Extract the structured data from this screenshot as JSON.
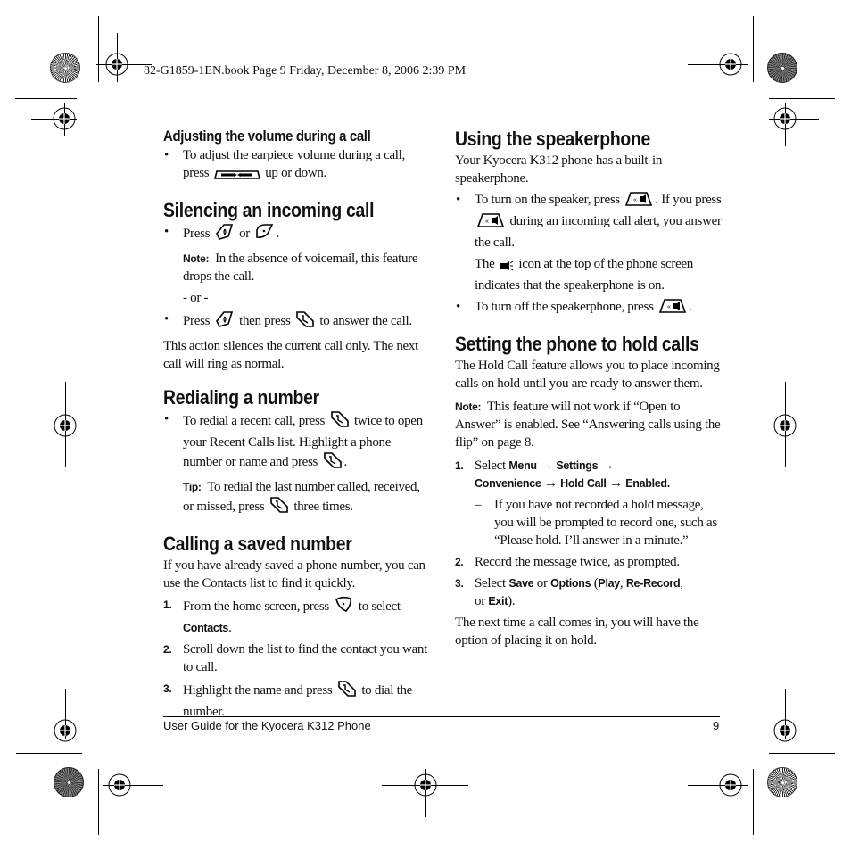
{
  "slug": "82-G1859-1EN.book  Page 9  Friday, December 8, 2006  2:39 PM",
  "left_column": {
    "adjust_volume": {
      "heading": "Adjusting the volume during a call",
      "bullet_pre": "To adjust the earpiece volume during a call, press",
      "bullet_post": "up or down.",
      "icon": "volume-key-icon"
    },
    "silencing": {
      "heading": "Silencing an incoming call",
      "bullet1_pre": "Press",
      "bullet1_mid": "or",
      "bullet1_post": ".",
      "note_label": "Note:",
      "note_text": "In the absence of voicemail, this feature drops the call.",
      "or_text": "- or -",
      "bullet2_pre": "Press",
      "bullet2_mid": "then press",
      "bullet2_post": "to answer the call.",
      "para": "This action silences the current call only. The next call will ring as normal."
    },
    "redialing": {
      "heading": "Redialing a number",
      "bullet_a": "To redial a recent call, press",
      "bullet_b": "twice to open your Recent Calls list. Highlight a phone number or name and press",
      "bullet_c": ".",
      "tip_label": "Tip:",
      "tip_pre": "To redial the last number called, received, or missed, press",
      "tip_post": "three times."
    },
    "calling_saved": {
      "heading": "Calling a saved number",
      "intro": "If you have already saved a phone number, you can use the Contacts list to find it quickly.",
      "steps": [
        {
          "num": "1.",
          "pre": "From the home screen, press",
          "mid": "to select",
          "bold": "Contacts",
          "post": "."
        },
        {
          "num": "2.",
          "text": "Scroll down the list to find the contact you want to call."
        },
        {
          "num": "3.",
          "pre": "Highlight the name and press",
          "post": "to dial the number."
        }
      ]
    }
  },
  "right_column": {
    "speakerphone": {
      "heading": "Using the speakerphone",
      "intro": "Your Kyocera K312 phone has a built-in speakerphone.",
      "bullet1_a": "To turn on the speaker, press",
      "bullet1_b": ". If you press",
      "bullet1_c": "during an incoming call alert, you answer the call.",
      "note_pre": "The",
      "note_post": "icon at the top of the phone screen indicates that the speakerphone is on.",
      "bullet2_pre": "To turn off the speakerphone, press",
      "bullet2_post": "."
    },
    "hold": {
      "heading": "Setting the phone to hold calls",
      "intro": "The Hold Call feature allows you to place incoming calls on hold until you are ready to answer them.",
      "note_label": "Note:",
      "note_text": "This feature will not work if “Open to Answer” is enabled. See “Answering calls using the flip” on page 8.",
      "step1_num": "1.",
      "step1_pre": "Select",
      "step1_path": [
        "Menu",
        "Settings",
        "Convenience",
        "Hold Call",
        "Enabled."
      ],
      "arrow": "→",
      "step1_sub_dash": "–",
      "step1_sub": "If you have not recorded a hold message, you will be prompted to record one, such as “Please hold. I’ll answer in a minute.”",
      "step2_num": "2.",
      "step2": "Record the message twice, as prompted.",
      "step3_num": "3.",
      "step3_pre": "Select",
      "step3_save": "Save",
      "step3_or": "or",
      "step3_options": "Options",
      "step3_open": " (",
      "step3_play": "Play",
      "step3_comma": ", ",
      "step3_rerecord": "Re-Record",
      "step3_comma2": ",",
      "step3_or2": "or",
      "step3_exit": "Exit",
      "step3_close": ").",
      "outro": "The next time a call comes in, you will have the option of placing it on hold."
    }
  },
  "footer": {
    "title": "User Guide for the Kyocera K312 Phone",
    "page_number": "9"
  }
}
